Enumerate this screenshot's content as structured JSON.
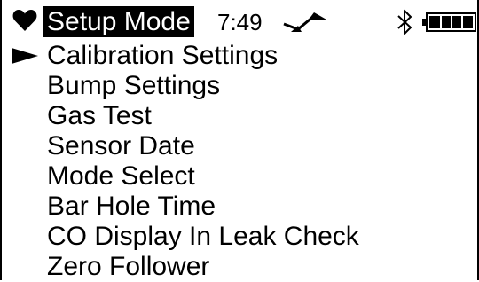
{
  "status": {
    "mode_title": "Setup Mode",
    "time": "7:49",
    "icons": [
      "heart-icon",
      "signal-icon",
      "bluetooth-icon",
      "battery-icon"
    ],
    "battery_level": 1.0
  },
  "menu": {
    "selected_index": 0,
    "items": [
      {
        "label": "Calibration Settings"
      },
      {
        "label": "Bump Settings"
      },
      {
        "label": "Gas Test"
      },
      {
        "label": "Sensor Date"
      },
      {
        "label": "Mode Select"
      },
      {
        "label": "Bar Hole Time"
      },
      {
        "label": "CO Display In Leak Check"
      },
      {
        "label": "Zero Follower"
      }
    ]
  }
}
